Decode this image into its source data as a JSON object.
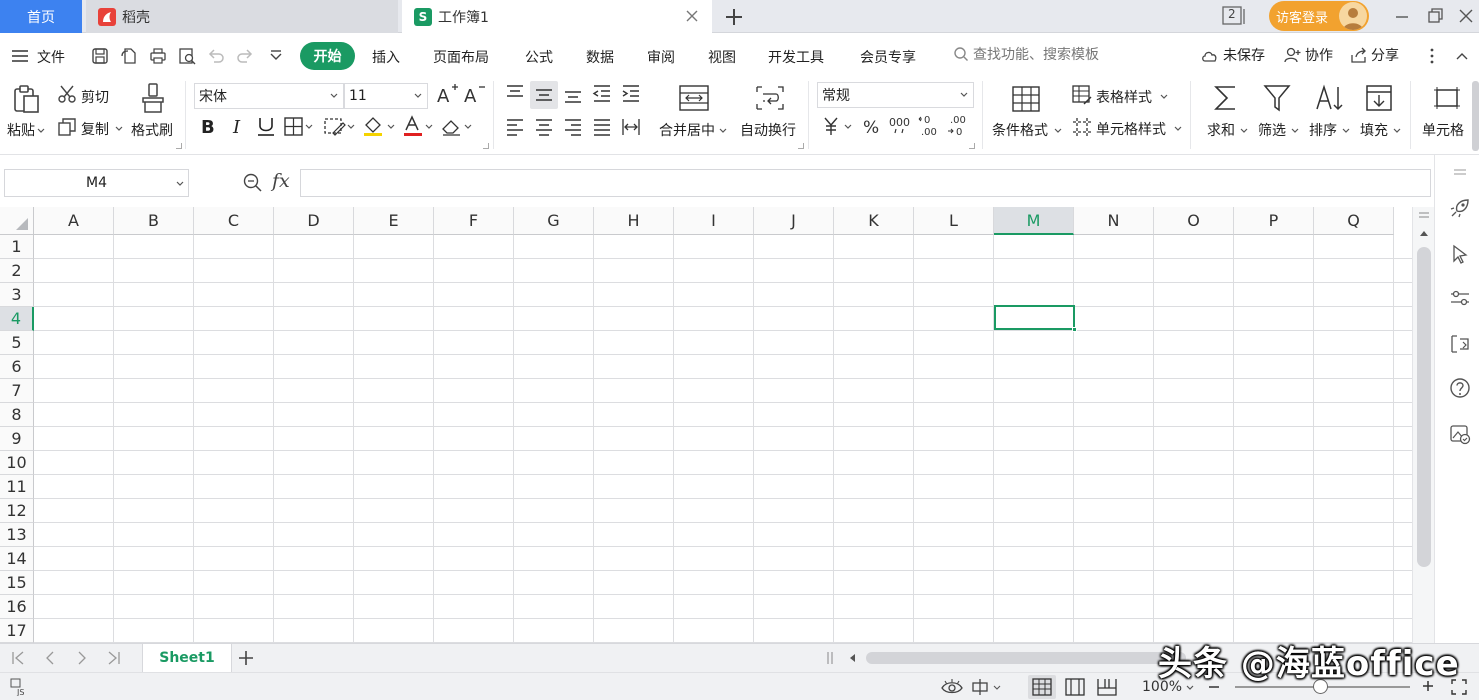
{
  "tabs": {
    "home": "首页",
    "daoke": "稻壳",
    "workbook": "工作簿1",
    "workbook_icon": "S",
    "login": "访客登录",
    "window_count": "2"
  },
  "menu": {
    "file": "文件",
    "items": [
      "开始",
      "插入",
      "页面布局",
      "公式",
      "数据",
      "审阅",
      "视图",
      "开发工具",
      "会员专享"
    ],
    "search_hint": "查找功能、搜索模板",
    "unsaved": "未保存",
    "collab": "协作",
    "share": "分享"
  },
  "ribbon": {
    "paste": "粘贴",
    "cut": "剪切",
    "copy": "复制",
    "format_painter": "格式刷",
    "font_name": "宋体",
    "font_size": "11",
    "merge_center": "合并居中",
    "wrap_text": "自动换行",
    "number_format": "常规",
    "conditional_format": "条件格式",
    "table_style": "表格样式",
    "cell_style": "单元格样式",
    "sum": "求和",
    "filter": "筛选",
    "sort": "排序",
    "fill": "填充",
    "cell": "单元格"
  },
  "formula_bar": {
    "name_box": "M4",
    "fx_label": "fx",
    "content": ""
  },
  "grid": {
    "columns": [
      "A",
      "B",
      "C",
      "D",
      "E",
      "F",
      "G",
      "H",
      "I",
      "J",
      "K",
      "L",
      "M",
      "N",
      "O",
      "P",
      "Q"
    ],
    "rows": [
      "1",
      "2",
      "3",
      "4",
      "5",
      "6",
      "7",
      "8",
      "9",
      "10",
      "11",
      "12",
      "13",
      "14",
      "15",
      "16",
      "17"
    ],
    "selected_column": "M",
    "selected_row": "4"
  },
  "sheets": {
    "tabs": [
      "Sheet1"
    ],
    "active": "Sheet1"
  },
  "status": {
    "zoom": "100%"
  },
  "watermark": "头条 @海蓝office",
  "colors": {
    "accent_green": "#1a9a63",
    "home_tab_blue": "#3d82f0",
    "login_orange": "#f2a22f",
    "daoke_red": "#e8423a"
  }
}
